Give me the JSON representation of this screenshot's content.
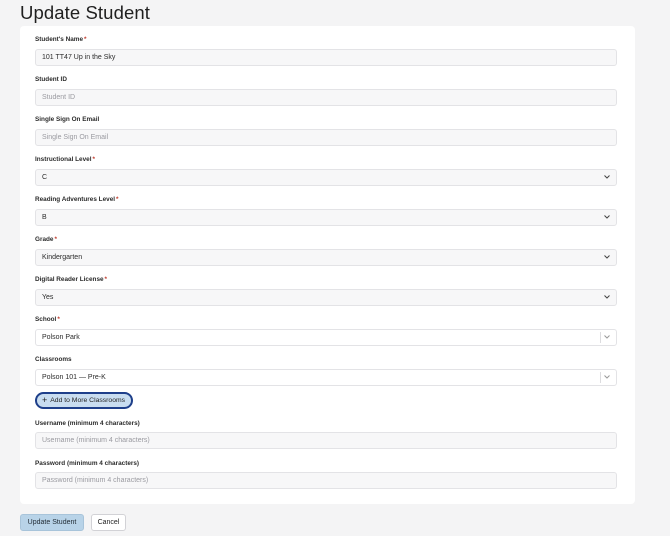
{
  "page": {
    "title": "Update Student"
  },
  "form": {
    "student_name": {
      "label": "Student's Name",
      "value": "101 TT47 Up in the Sky"
    },
    "student_id": {
      "label": "Student ID",
      "placeholder": "Student ID"
    },
    "sso_email": {
      "label": "Single Sign On Email",
      "placeholder": "Single Sign On Email"
    },
    "instructional_level": {
      "label": "Instructional Level",
      "value": "C"
    },
    "reading_adventures_level": {
      "label": "Reading Adventures Level",
      "value": "B"
    },
    "grade": {
      "label": "Grade",
      "value": "Kindergarten"
    },
    "digital_reader_license": {
      "label": "Digital Reader License",
      "value": "Yes"
    },
    "school": {
      "label": "School",
      "value": "Polson Park"
    },
    "classrooms": {
      "label": "Classrooms",
      "value": "Polson 101 — Pre-K"
    },
    "add_classrooms_label": "Add to More Classrooms",
    "username": {
      "label": "Username (minimum 4 characters)",
      "placeholder": "Username (minimum 4 characters)"
    },
    "password": {
      "label": "Password (minimum 4 characters)",
      "placeholder": "Password (minimum 4 characters)"
    },
    "required_marker": "*"
  },
  "actions": {
    "submit_label": "Update Student",
    "cancel_label": "Cancel"
  },
  "icons": {
    "dropdown": "chevron-down-icon",
    "add": "plus-icon"
  },
  "colors": {
    "required": "#c0392b",
    "add_button_border": "#1e3f8a",
    "primary_button": "#b8d3e8"
  }
}
